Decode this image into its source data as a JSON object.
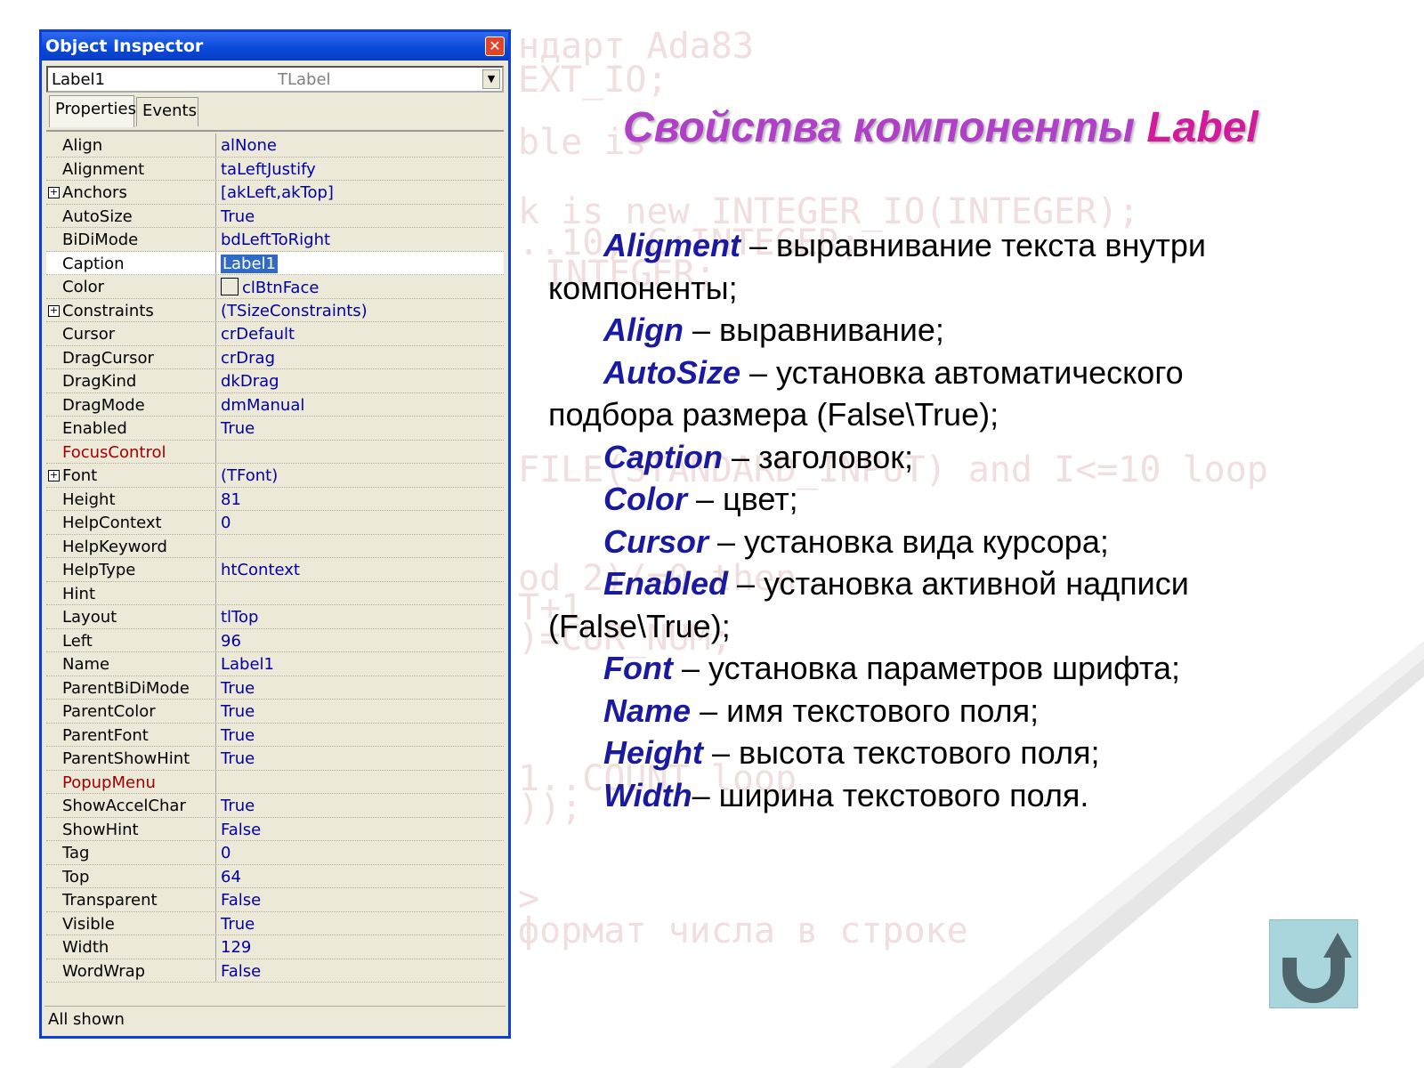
{
  "background_code": [
    "ндарт Ada83",
    "EXT_IO;",
    "ble is",
    "k is new INTEGER_IO(INTEGER);",
    "..10; C:INTEGER;",
    "INTEGER;",
    "FILE(STANDARD_INPUT) and I<=10 loop",
    "od 2)/=0 then",
    "T+1",
    ")=CUR_NUM;",
    "1..COUNT loop",
    "));",
    ">",
    "формат числа в строке"
  ],
  "inspector": {
    "title": "Object Inspector",
    "object_name": "Label1",
    "object_type": "TLabel",
    "tabs": [
      "Properties",
      "Events"
    ],
    "status": "All shown",
    "properties": [
      {
        "name": "Align",
        "value": "alNone"
      },
      {
        "name": "Alignment",
        "value": "taLeftJustify"
      },
      {
        "name": "Anchors",
        "value": "[akLeft,akTop]",
        "expandable": true
      },
      {
        "name": "AutoSize",
        "value": "True"
      },
      {
        "name": "BiDiMode",
        "value": "bdLeftToRight"
      },
      {
        "name": "Caption",
        "value": "Label1",
        "selected": true
      },
      {
        "name": "Color",
        "value": "clBtnFace",
        "swatch": true
      },
      {
        "name": "Constraints",
        "value": "(TSizeConstraints)",
        "expandable": true
      },
      {
        "name": "Cursor",
        "value": "crDefault"
      },
      {
        "name": "DragCursor",
        "value": "crDrag"
      },
      {
        "name": "DragKind",
        "value": "dkDrag"
      },
      {
        "name": "DragMode",
        "value": "dmManual"
      },
      {
        "name": "Enabled",
        "value": "True"
      },
      {
        "name": "FocusControl",
        "value": "",
        "reference": true
      },
      {
        "name": "Font",
        "value": "(TFont)",
        "expandable": true
      },
      {
        "name": "Height",
        "value": "81"
      },
      {
        "name": "HelpContext",
        "value": "0"
      },
      {
        "name": "HelpKeyword",
        "value": ""
      },
      {
        "name": "HelpType",
        "value": "htContext"
      },
      {
        "name": "Hint",
        "value": ""
      },
      {
        "name": "Layout",
        "value": "tlTop"
      },
      {
        "name": "Left",
        "value": "96"
      },
      {
        "name": "Name",
        "value": "Label1"
      },
      {
        "name": "ParentBiDiMode",
        "value": "True"
      },
      {
        "name": "ParentColor",
        "value": "True"
      },
      {
        "name": "ParentFont",
        "value": "True"
      },
      {
        "name": "ParentShowHint",
        "value": "True"
      },
      {
        "name": "PopupMenu",
        "value": "",
        "reference": true
      },
      {
        "name": "ShowAccelChar",
        "value": "True"
      },
      {
        "name": "ShowHint",
        "value": "False"
      },
      {
        "name": "Tag",
        "value": "0"
      },
      {
        "name": "Top",
        "value": "64"
      },
      {
        "name": "Transparent",
        "value": "False"
      },
      {
        "name": "Visible",
        "value": "True"
      },
      {
        "name": "Width",
        "value": "129"
      },
      {
        "name": "WordWrap",
        "value": "False"
      }
    ]
  },
  "slide": {
    "title_prefix": "Свойства компоненты ",
    "title_highlight": "Label",
    "items": [
      {
        "kw": "Aligment",
        "text": " – выравнивание текста внутри"
      },
      {
        "cont": "компоненты;"
      },
      {
        "kw": "Align",
        "text": " – выравнивание;"
      },
      {
        "kw": "AutoSize",
        "text": " – установка автоматического"
      },
      {
        "cont": "подбора размера (False\\True);"
      },
      {
        "kw": "Caption",
        "text": " – заголовок;"
      },
      {
        "kw": "Color",
        "text": " – цвет;"
      },
      {
        "kw": "Cursor",
        "text": " – установка вида курсора;"
      },
      {
        "kw": "Enabled",
        "text": " – установка активной надписи"
      },
      {
        "cont": "(False\\True);"
      },
      {
        "kw": "Font",
        "text": " – установка параметров шрифта;"
      },
      {
        "kw": "Name",
        "text": " – имя текстового поля;"
      },
      {
        "kw": "Height",
        "text": " – высота текстового поля;"
      },
      {
        "kw": "Width",
        "text": "– ширина текстового поля."
      }
    ]
  },
  "back_button_icon": "u-turn-arrow-icon"
}
